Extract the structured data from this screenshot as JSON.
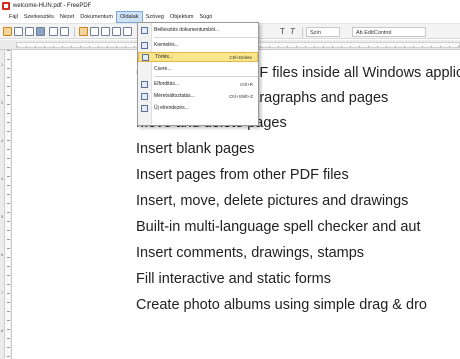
{
  "window": {
    "title": "welcome-HUN.pdf - FreePDF"
  },
  "menubar": {
    "items": [
      "Fájl",
      "Szerkesztés",
      "Nézet",
      "Dokumentum",
      "Oldalak",
      "Szöveg",
      "Objektum",
      "Súgó"
    ],
    "active": "Oldalak"
  },
  "toolbar": {
    "text_tool": "T",
    "text_tool_alt": "T",
    "color_label": "Szín",
    "control_label": "Ab EditControl"
  },
  "ruler": {
    "numbers": [
      "1",
      "2",
      "3",
      "4",
      "5",
      "6",
      "7",
      "8"
    ]
  },
  "dropdown": {
    "items": [
      {
        "label": "Beillesztés dokumentumból...",
        "shortcut": "",
        "icon": "insert-document-icon"
      },
      {
        "label": "Kiemelés...",
        "shortcut": "",
        "icon": "extract-icon"
      },
      {
        "label": "Törlés...",
        "shortcut": "Ctrl+Delete",
        "icon": "delete-page-icon",
        "highlighted": true
      },
      {
        "label": "Csere...",
        "shortcut": "",
        "icon": ""
      },
      {
        "label": "Elforditás...",
        "shortcut": "Ctrl+R",
        "icon": "rotate-icon"
      },
      {
        "label": "Méretváltoztatás...",
        "shortcut": "Ctrl+Shift+Z",
        "icon": "resize-icon"
      },
      {
        "label": "Új elrendezés...",
        "shortcut": "",
        "icon": "new-layout-icon"
      }
    ]
  },
  "page": {
    "lines": [
      "Create and edit PDF files inside all Windows applica",
      "Edit text, tables, paragraphs and pages",
      "Move and delete pages",
      "Insert blank pages",
      "Insert pages from other PDF files",
      "Insert, move, delete pictures and drawings",
      "Built-in multi-language spell checker and aut",
      "Insert comments, drawings, stamps",
      "Fill interactive and static forms",
      "Create photo albums using simple drag & dro"
    ]
  },
  "colors": {
    "menu_highlight": "#fbe58a",
    "active_menu": "#cfe3f7",
    "app_icon": "#d62b1f"
  }
}
